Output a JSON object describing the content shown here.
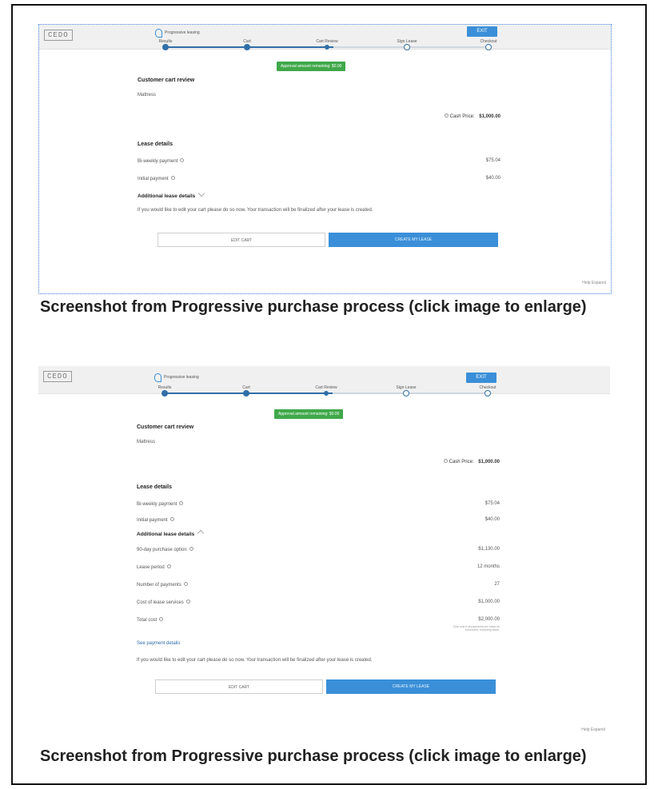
{
  "screens": [
    {
      "logo": "CEDO",
      "brand": "Progressive leasing",
      "exit": "EXIT",
      "steps": [
        "Results",
        "Cart",
        "Cart Review",
        "Sign Lease",
        "Checkout"
      ],
      "approval": "Approval amount remaining: $0.00",
      "cart_title": "Customer cart review",
      "item": "Mattress",
      "cash_label": "Cash Price:",
      "cash_value": "$1,000.00",
      "lease_title": "Lease details",
      "biweekly_label": "Bi-weekly payment",
      "biweekly_value": "$75.04",
      "initial_label": "Initial payment",
      "initial_value": "$40.00",
      "additional_label": "Additional lease details",
      "note": "If you would like to edit your cart please do so now. Your transaction will be finalized after your lease is created.",
      "edit_cart": "EDIT CART",
      "create_lease": "CREATE MY LEASE",
      "footer": "Help  Espanol"
    },
    {
      "logo": "CEDO",
      "brand": "Progressive leasing",
      "exit": "EXIT",
      "steps": [
        "Results",
        "Cart",
        "Cart Review",
        "Sign Lease",
        "Checkout"
      ],
      "approval": "Approval amount remaining: $0.00",
      "cart_title": "Customer cart review",
      "item": "Mattress",
      "cash_label": "Cash Price:",
      "cash_value": "$1,000.00",
      "lease_title": "Lease details",
      "biweekly_label": "Bi-weekly payment",
      "biweekly_value": "$75.04",
      "initial_label": "Initial payment",
      "initial_value": "$40.00",
      "additional_label": "Additional lease details",
      "purchase_option_label": "90-day purchase option",
      "purchase_option_value": "$1,130.00",
      "lease_period_label": "Lease period",
      "lease_period_value": "12 months",
      "num_payments_label": "Number of payments",
      "num_payments_value": "27",
      "cost_label": "Cost of lease services",
      "cost_value": "$1,000.00",
      "total_label": "Total cost",
      "total_value": "$2,000.00",
      "total_note": "Total cost if all payments are made as scheduled, excluding taxes.",
      "see_payment": "See payment details",
      "note": "If you would like to edit your cart please do so now. Your transaction will be finalized after your lease is created.",
      "edit_cart": "EDIT CART",
      "create_lease": "CREATE MY LEASE",
      "footer": "Help  Espanol"
    }
  ],
  "captions": [
    "Screenshot from Progressive purchase process (click image to enlarge)",
    "Screenshot from Progressive purchase process (click image to enlarge)"
  ]
}
